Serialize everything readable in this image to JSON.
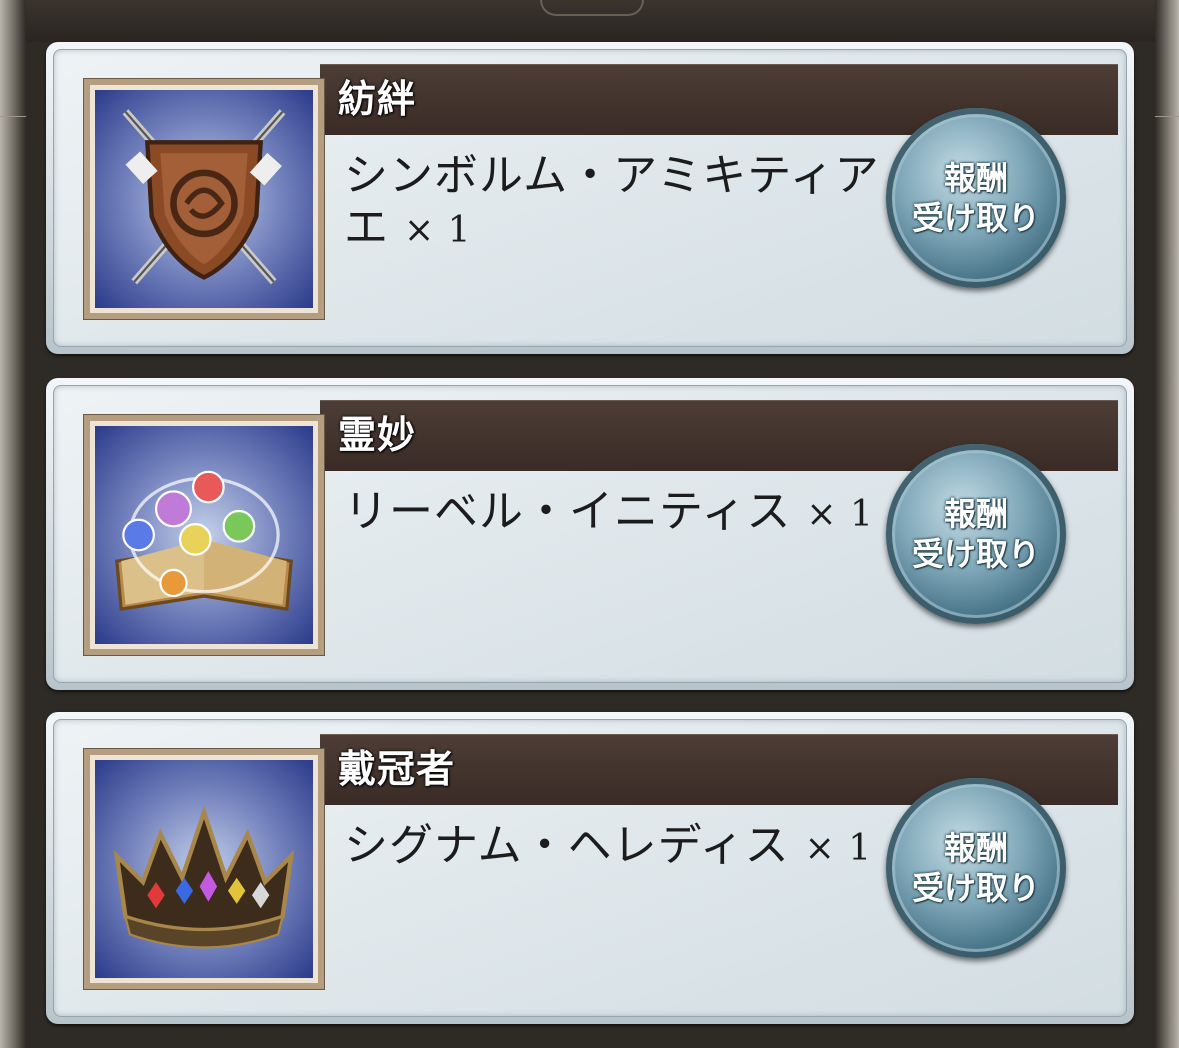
{
  "rewards": [
    {
      "category": "紡絆",
      "item_lines": [
        "シンボルム・アミキティア",
        "エ"
      ],
      "quantity": "× 1",
      "icon": "shield-icon",
      "button_line1": "報酬",
      "button_line2": "受け取り"
    },
    {
      "category": "霊妙",
      "item_lines": [
        "リーベル・イニティス",
        ""
      ],
      "quantity": "× 1",
      "icon": "spellbook-icon",
      "button_line1": "報酬",
      "button_line2": "受け取り"
    },
    {
      "category": "戴冠者",
      "item_lines": [
        "シグナム・ヘレディス",
        ""
      ],
      "quantity": "× 1",
      "icon": "crown-icon",
      "button_line1": "報酬",
      "button_line2": "受け取り"
    }
  ]
}
